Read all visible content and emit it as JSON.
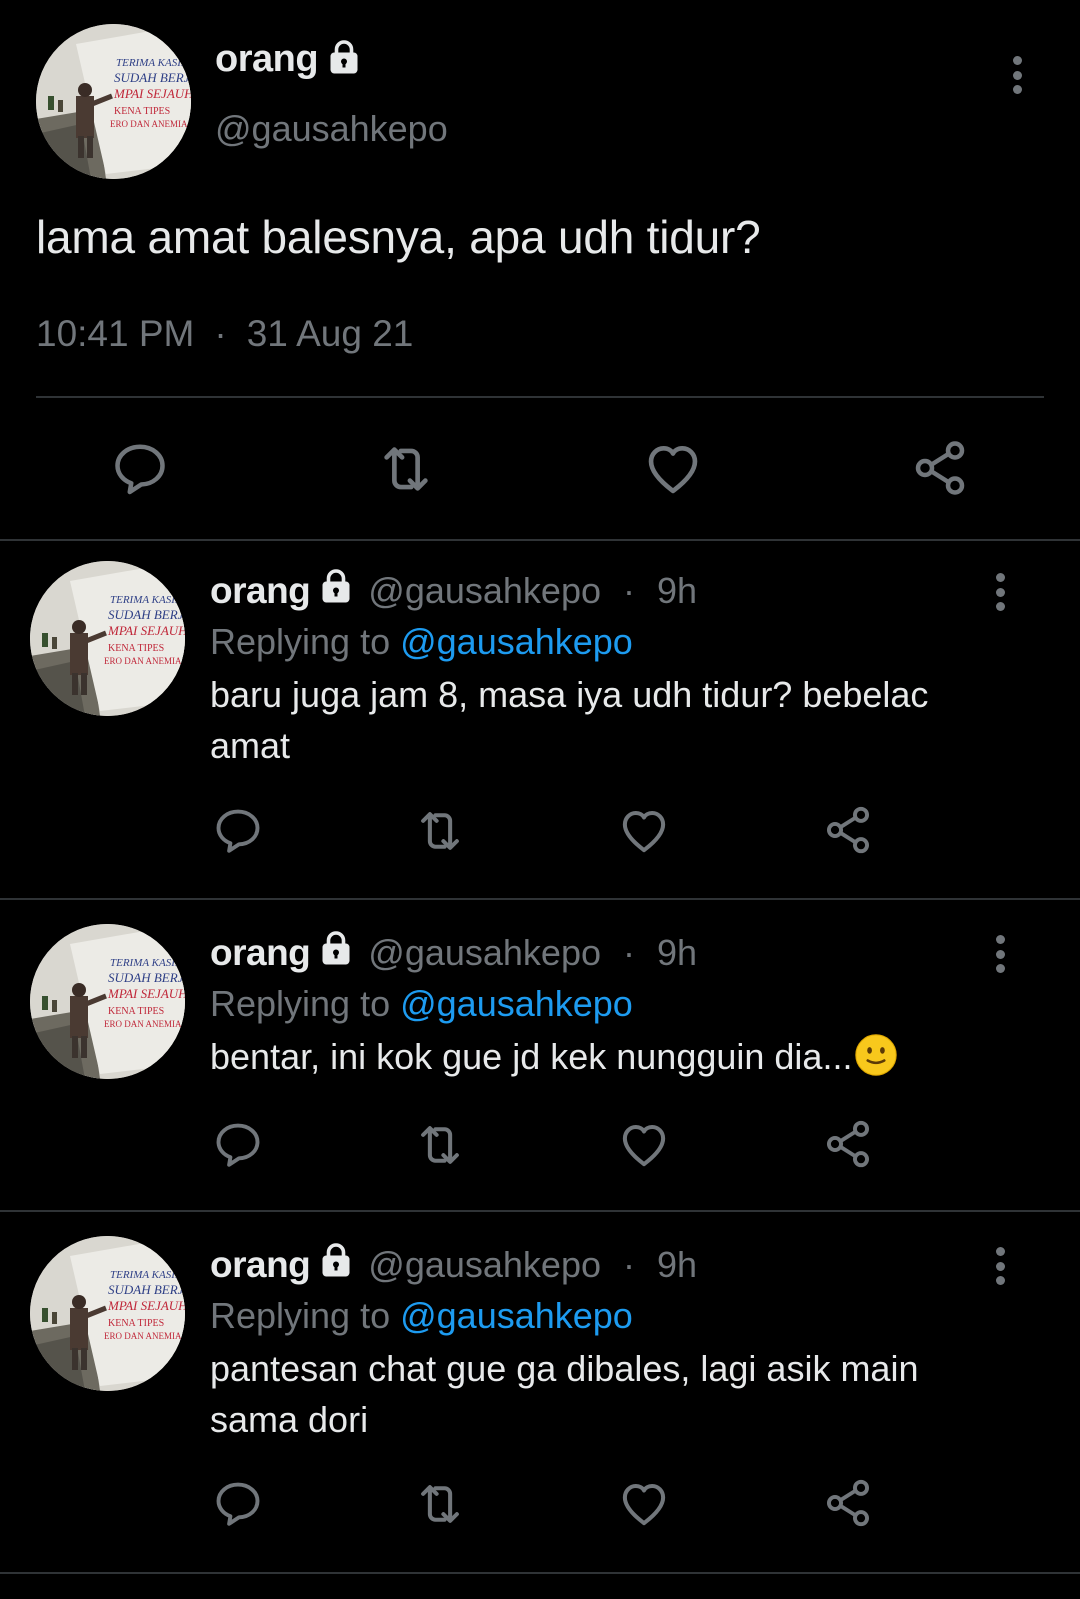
{
  "main_tweet": {
    "display_name": "orang",
    "handle": "@gausahkepo",
    "text": "lama amat balesnya, apa udh tidur?",
    "time": "10:41 PM",
    "separator": "·",
    "date": "31 Aug 21"
  },
  "replies": [
    {
      "display_name": "orang",
      "handle": "@gausahkepo",
      "separator": "·",
      "time": "9h",
      "replying_prefix": "Replying to ",
      "replying_to": "@gausahkepo",
      "text": "baru juga jam 8, masa iya udh tidur? bebelac amat"
    },
    {
      "display_name": "orang",
      "handle": "@gausahkepo",
      "separator": "·",
      "time": "9h",
      "replying_prefix": "Replying to ",
      "replying_to": "@gausahkepo",
      "text": "bentar, ini kok gue jd kek nungguin dia..."
    },
    {
      "display_name": "orang",
      "handle": "@gausahkepo",
      "separator": "·",
      "time": "9h",
      "replying_prefix": "Replying to ",
      "replying_to": "@gausahkepo",
      "text": "pantesan chat gue ga dibales, lagi asik main sama dori"
    }
  ],
  "icons": {
    "reply": "reply-icon",
    "retweet": "retweet-icon",
    "like": "heart-icon",
    "share": "share-icon",
    "lock": "lock-icon",
    "more": "more-icon",
    "emoji": "slightly-smiling-face-emoji"
  },
  "colors": {
    "background": "#000000",
    "text_primary": "#e7e9ea",
    "text_secondary": "#71767b",
    "link": "#1d9bf0",
    "divider": "#2f3336"
  }
}
